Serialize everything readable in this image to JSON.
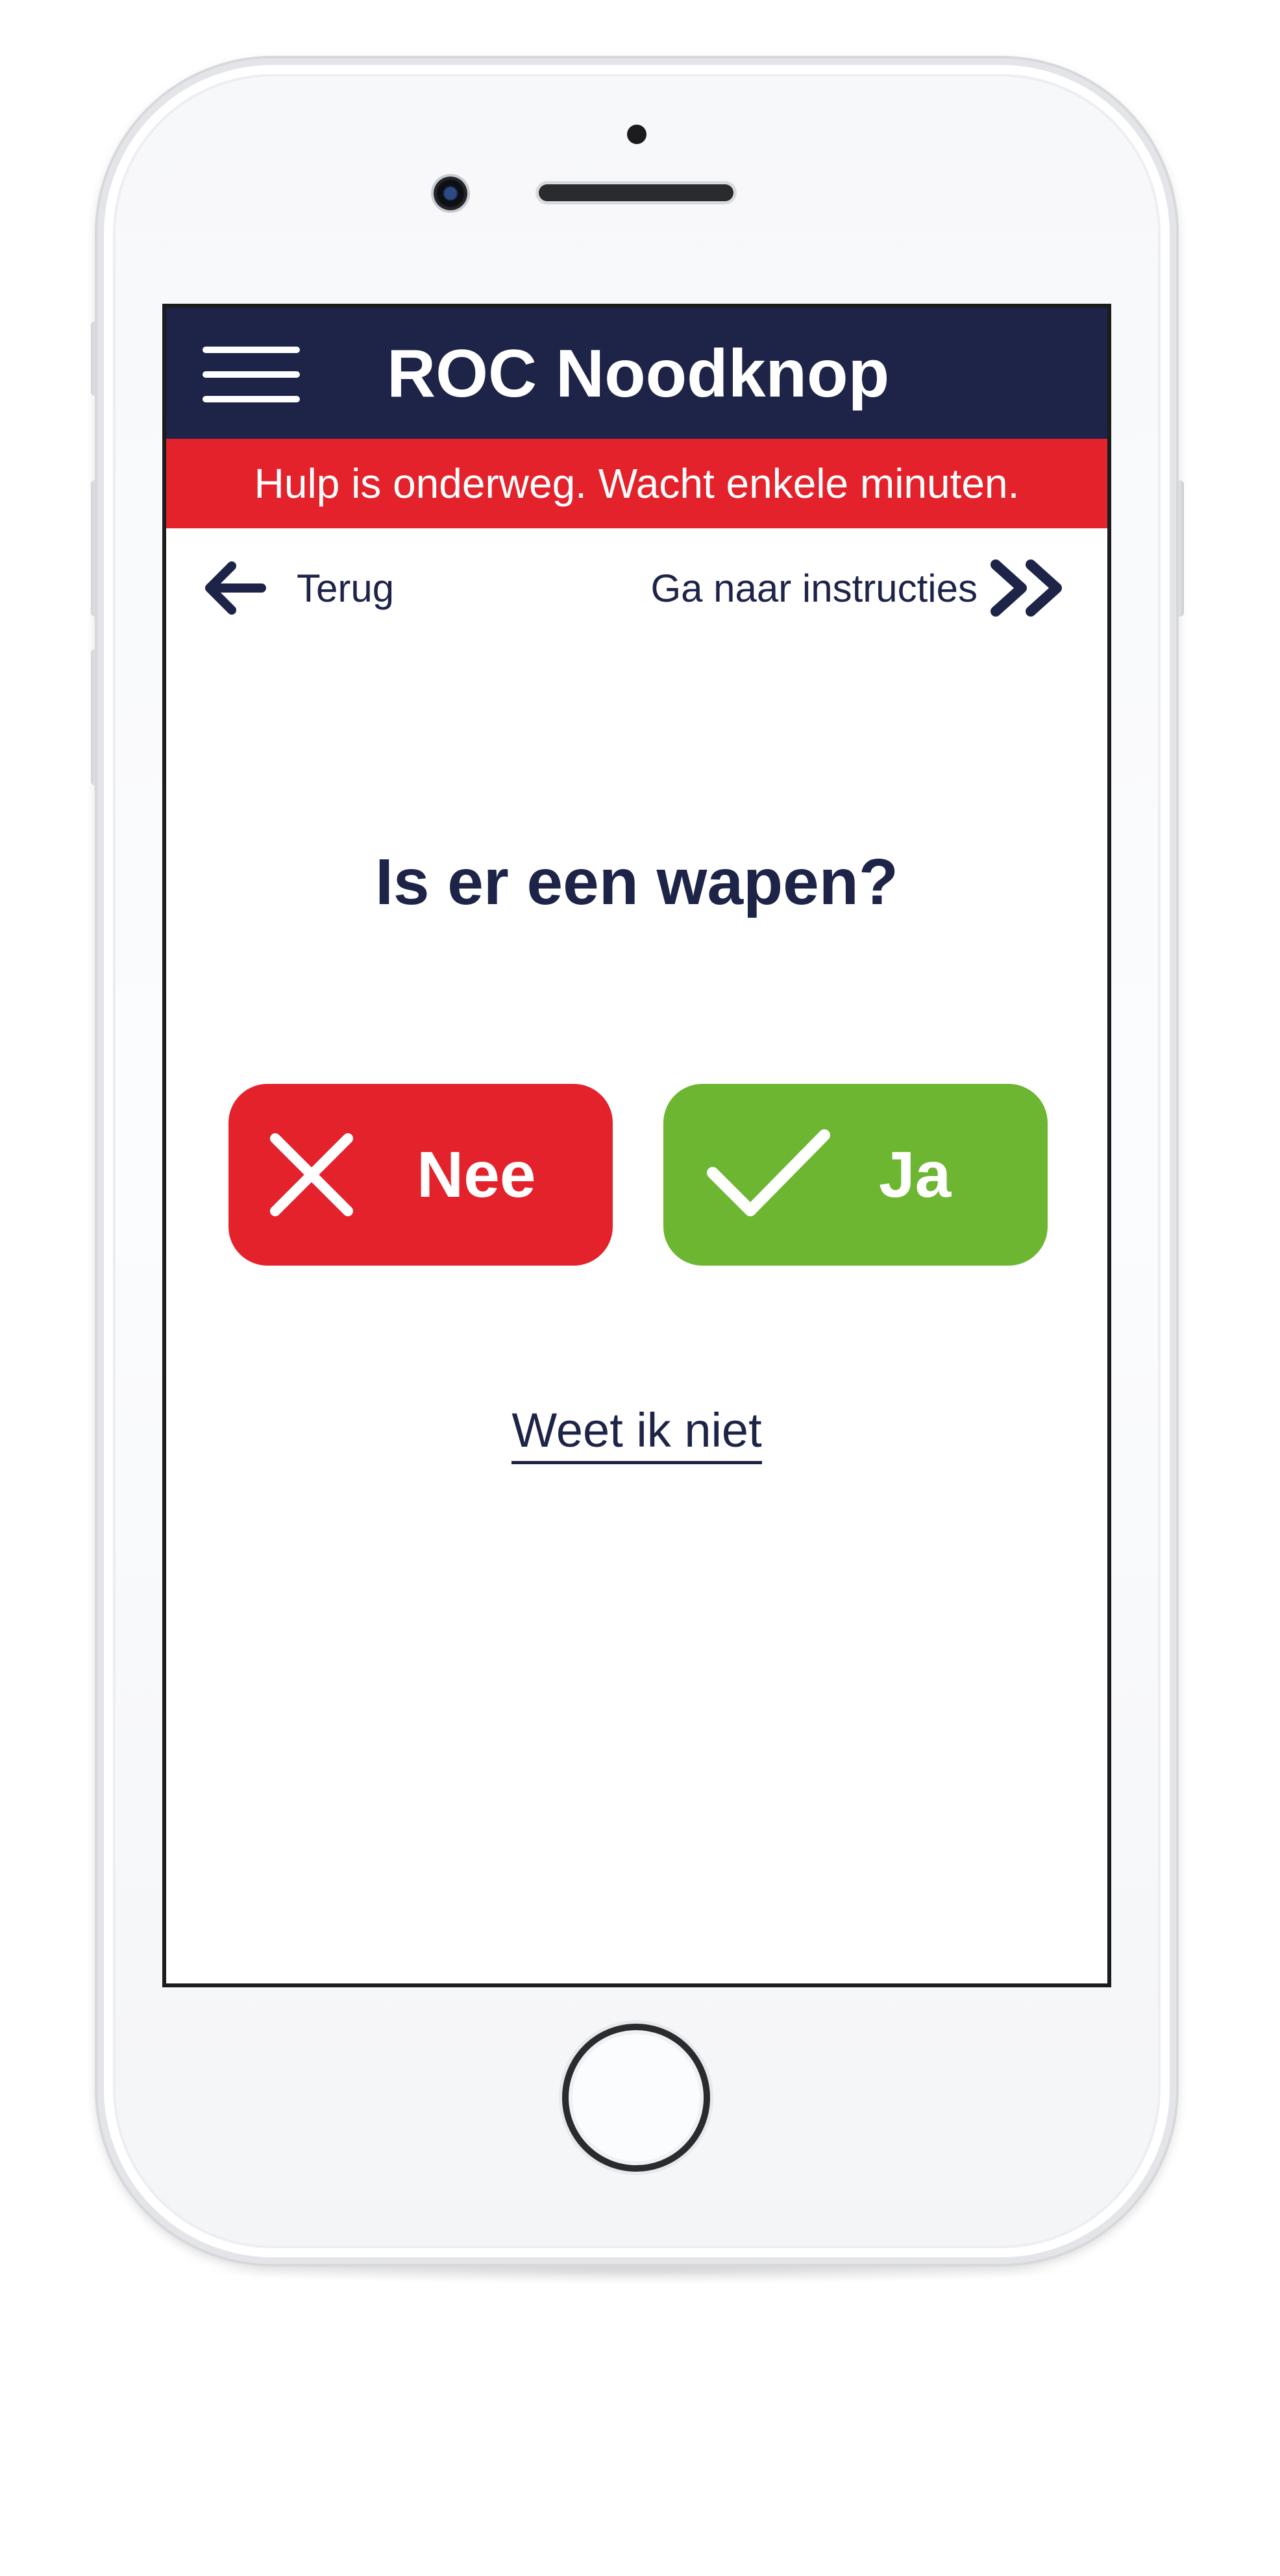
{
  "app": {
    "title": "ROC Noodknop"
  },
  "alert": {
    "text": "Hulp is onderweg. Wacht enkele minuten."
  },
  "nav": {
    "back_label": "Terug",
    "forward_label": "Ga naar instructies"
  },
  "question": {
    "text": "Is er een wapen?"
  },
  "answers": {
    "no_label": "Nee",
    "yes_label": "Ja",
    "unknown_label": "Weet ik niet"
  },
  "icons": {
    "menu": "hamburger-icon",
    "back": "arrow-left-icon",
    "forward": "double-chevron-right-icon",
    "no": "cross-icon",
    "yes": "checkmark-icon"
  },
  "colors": {
    "header_navy": "#1e2448",
    "alert_red": "#e3222b",
    "no_red": "#e3222b",
    "yes_green": "#6db631",
    "text_navy": "#1e2448"
  }
}
